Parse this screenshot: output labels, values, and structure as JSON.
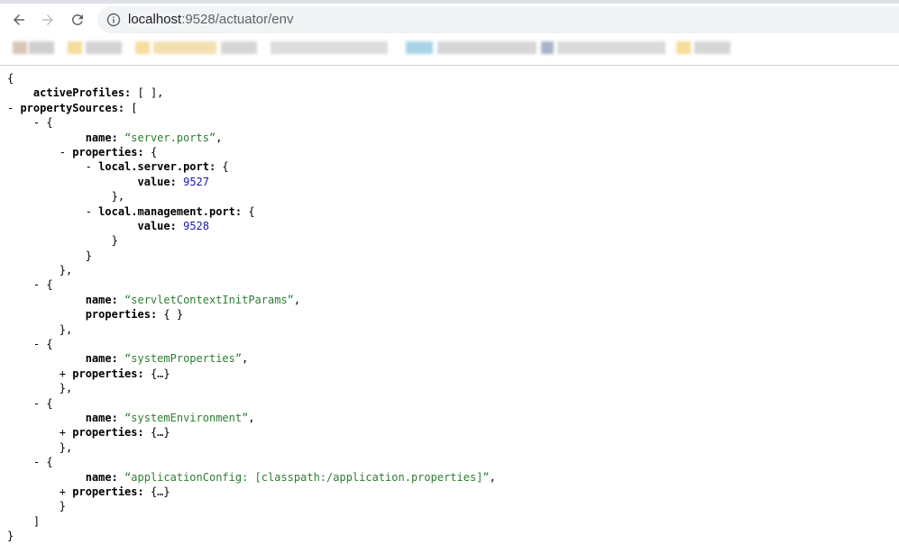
{
  "browser": {
    "url_host": "localhost",
    "url_rest": ":9528/actuator/env"
  },
  "json_lines": [
    {
      "indent": 0,
      "parts": [
        {
          "t": "p",
          "v": "{"
        }
      ]
    },
    {
      "indent": 4,
      "parts": [
        {
          "t": "k",
          "v": "activeProfiles:"
        },
        {
          "t": "p",
          "v": " [ ],"
        }
      ]
    },
    {
      "indent": 2,
      "toggle": "- ",
      "parts": [
        {
          "t": "k",
          "v": "propertySources:"
        },
        {
          "t": "p",
          "v": " ["
        }
      ]
    },
    {
      "indent": 6,
      "toggle": "- ",
      "parts": [
        {
          "t": "p",
          "v": "{"
        }
      ]
    },
    {
      "indent": 12,
      "parts": [
        {
          "t": "k",
          "v": "name:"
        },
        {
          "t": "p",
          "v": " "
        },
        {
          "t": "s",
          "v": "“server.ports”"
        },
        {
          "t": "p",
          "v": ","
        }
      ]
    },
    {
      "indent": 10,
      "toggle": "- ",
      "parts": [
        {
          "t": "k",
          "v": "properties:"
        },
        {
          "t": "p",
          "v": " {"
        }
      ]
    },
    {
      "indent": 14,
      "toggle": "- ",
      "parts": [
        {
          "t": "k",
          "v": "local.server.port:"
        },
        {
          "t": "p",
          "v": " {"
        }
      ]
    },
    {
      "indent": 20,
      "parts": [
        {
          "t": "k",
          "v": "value:"
        },
        {
          "t": "p",
          "v": " "
        },
        {
          "t": "n",
          "v": "9527"
        }
      ]
    },
    {
      "indent": 16,
      "parts": [
        {
          "t": "p",
          "v": "},"
        }
      ]
    },
    {
      "indent": 14,
      "toggle": "- ",
      "parts": [
        {
          "t": "k",
          "v": "local.management.port:"
        },
        {
          "t": "p",
          "v": " {"
        }
      ]
    },
    {
      "indent": 20,
      "parts": [
        {
          "t": "k",
          "v": "value:"
        },
        {
          "t": "p",
          "v": " "
        },
        {
          "t": "n",
          "v": "9528"
        }
      ]
    },
    {
      "indent": 16,
      "parts": [
        {
          "t": "p",
          "v": "}"
        }
      ]
    },
    {
      "indent": 12,
      "parts": [
        {
          "t": "p",
          "v": "}"
        }
      ]
    },
    {
      "indent": 8,
      "parts": [
        {
          "t": "p",
          "v": "},"
        }
      ]
    },
    {
      "indent": 6,
      "toggle": "- ",
      "parts": [
        {
          "t": "p",
          "v": "{"
        }
      ]
    },
    {
      "indent": 12,
      "parts": [
        {
          "t": "k",
          "v": "name:"
        },
        {
          "t": "p",
          "v": " "
        },
        {
          "t": "s",
          "v": "“servletContextInitParams”"
        },
        {
          "t": "p",
          "v": ","
        }
      ]
    },
    {
      "indent": 12,
      "parts": [
        {
          "t": "k",
          "v": "properties:"
        },
        {
          "t": "p",
          "v": " { }"
        }
      ]
    },
    {
      "indent": 8,
      "parts": [
        {
          "t": "p",
          "v": "},"
        }
      ]
    },
    {
      "indent": 6,
      "toggle": "- ",
      "parts": [
        {
          "t": "p",
          "v": "{"
        }
      ]
    },
    {
      "indent": 12,
      "parts": [
        {
          "t": "k",
          "v": "name:"
        },
        {
          "t": "p",
          "v": " "
        },
        {
          "t": "s",
          "v": "“systemProperties”"
        },
        {
          "t": "p",
          "v": ","
        }
      ]
    },
    {
      "indent": 10,
      "toggle": "+ ",
      "parts": [
        {
          "t": "k",
          "v": "properties:"
        },
        {
          "t": "p",
          "v": " {…}"
        }
      ]
    },
    {
      "indent": 8,
      "parts": [
        {
          "t": "p",
          "v": "},"
        }
      ]
    },
    {
      "indent": 6,
      "toggle": "- ",
      "parts": [
        {
          "t": "p",
          "v": "{"
        }
      ]
    },
    {
      "indent": 12,
      "parts": [
        {
          "t": "k",
          "v": "name:"
        },
        {
          "t": "p",
          "v": " "
        },
        {
          "t": "s",
          "v": "“systemEnvironment”"
        },
        {
          "t": "p",
          "v": ","
        }
      ]
    },
    {
      "indent": 10,
      "toggle": "+ ",
      "parts": [
        {
          "t": "k",
          "v": "properties:"
        },
        {
          "t": "p",
          "v": " {…}"
        }
      ]
    },
    {
      "indent": 8,
      "parts": [
        {
          "t": "p",
          "v": "},"
        }
      ]
    },
    {
      "indent": 6,
      "toggle": "- ",
      "parts": [
        {
          "t": "p",
          "v": "{"
        }
      ]
    },
    {
      "indent": 12,
      "parts": [
        {
          "t": "k",
          "v": "name:"
        },
        {
          "t": "p",
          "v": " "
        },
        {
          "t": "s",
          "v": "“applicationConfig: [classpath:/application.properties]”"
        },
        {
          "t": "p",
          "v": ","
        }
      ]
    },
    {
      "indent": 10,
      "toggle": "+ ",
      "parts": [
        {
          "t": "k",
          "v": "properties:"
        },
        {
          "t": "p",
          "v": " {…}"
        }
      ]
    },
    {
      "indent": 8,
      "parts": [
        {
          "t": "p",
          "v": "}"
        }
      ]
    },
    {
      "indent": 4,
      "parts": [
        {
          "t": "p",
          "v": "]"
        }
      ]
    },
    {
      "indent": 0,
      "parts": [
        {
          "t": "p",
          "v": "}"
        }
      ]
    }
  ]
}
